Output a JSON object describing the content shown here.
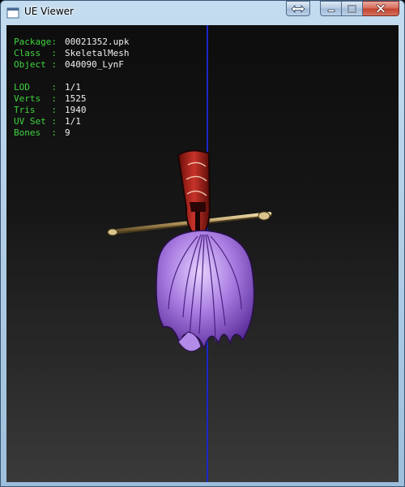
{
  "window": {
    "title": "UE Viewer",
    "caption_buttons": [
      "swap",
      "minimize",
      "maximize",
      "close"
    ]
  },
  "info_panel": {
    "rows": [
      {
        "label": "Package:",
        "value": "00021352.upk"
      },
      {
        "label": "Class  :",
        "value": "SkeletalMesh"
      },
      {
        "label": "Object :",
        "value": "040090_LynF"
      },
      {
        "label": "LOD    :",
        "value": "1/1"
      },
      {
        "label": "Verts  :",
        "value": "1525"
      },
      {
        "label": "Tris   :",
        "value": "1940"
      },
      {
        "label": "UV Set :",
        "value": "1/1"
      },
      {
        "label": "Bones  :",
        "value": "9"
      }
    ]
  },
  "colors": {
    "label": "#3fd43f",
    "value": "#f0f0f0",
    "axis": "#1a28c8",
    "mesh_hair": "#a77ae0",
    "mesh_band": "#b8281e",
    "mesh_rod": "#c9b27a"
  }
}
